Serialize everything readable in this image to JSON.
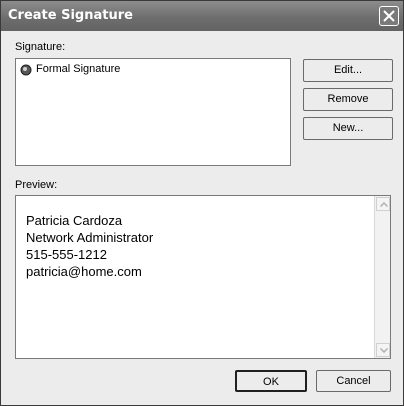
{
  "window": {
    "title": "Create Signature",
    "close_icon": "close-x-icon"
  },
  "signature": {
    "label": "Signature:",
    "items": [
      {
        "label": "Formal Signature",
        "icon": "signature-document-icon"
      }
    ],
    "buttons": {
      "edit": "Edit...",
      "remove": "Remove",
      "new": "New..."
    }
  },
  "preview": {
    "label": "Preview:",
    "lines": [
      "Patricia Cardoza",
      "Network Administrator",
      "515-555-1212",
      "patricia@home.com"
    ]
  },
  "footer": {
    "ok": "OK",
    "cancel": "Cancel"
  }
}
